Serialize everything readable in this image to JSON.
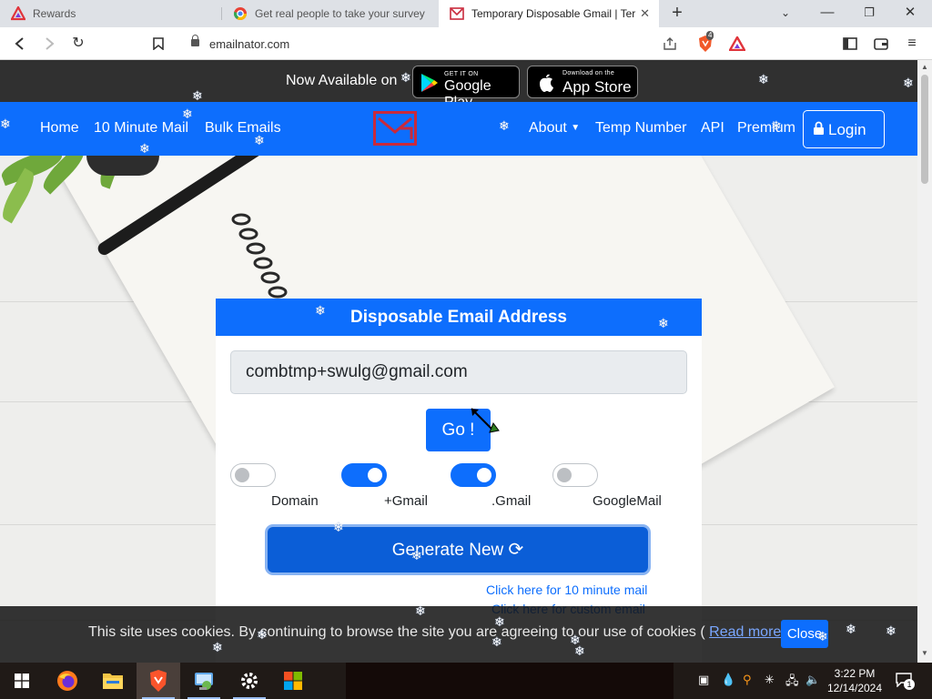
{
  "browser": {
    "tabs": [
      {
        "title": "Rewards",
        "active": false
      },
      {
        "title": "Get real people to take your survey",
        "active": false
      },
      {
        "title": "Temporary Disposable Gmail | Ter",
        "active": true
      }
    ],
    "new_tab": "+",
    "url": "emailnator.com",
    "shields_badge": "4"
  },
  "banner": {
    "text": "Now Available on",
    "google_play_small": "GET IT ON",
    "google_play_big": "Google Play",
    "app_store_small": "Download on the",
    "app_store_big": "App Store"
  },
  "nav": {
    "home": "Home",
    "ten_minute_mail": "10 Minute Mail",
    "bulk_emails": "Bulk Emails",
    "about": "About",
    "temp_number": "Temp Number",
    "api": "API",
    "premium": "Premium",
    "login": "Login"
  },
  "card": {
    "title": "Disposable Email Address",
    "email_value": "combtmp+swulg@gmail.com",
    "go_label": "Go !",
    "options": [
      {
        "label": "Domain",
        "enabled": false
      },
      {
        "label": "+Gmail",
        "enabled": true
      },
      {
        "label": ".Gmail",
        "enabled": true
      },
      {
        "label": "GoogleMail",
        "enabled": false
      }
    ],
    "generate_label": "Generate New",
    "link_ten_minute": "Click here for 10 minute mail",
    "link_custom": "Click here for custom email"
  },
  "cookie": {
    "text_before": "This site uses cookies. By continuing to browse the site you are agreeing to our use of cookies (",
    "read_more": "Read more",
    "text_after": ")",
    "close_label": "Close"
  },
  "taskbar": {
    "apps": [
      "firefox-icon",
      "file-explorer-icon",
      "brave-icon",
      "control-panel-icon",
      "settings-icon",
      "microsoft-store-icon"
    ],
    "time": "3:22 PM",
    "date": "12/14/2024",
    "notification_count": "1"
  },
  "colors": {
    "brand_blue": "#0d6efd",
    "banner_dark": "#303030",
    "logo_red": "#c92a3c"
  }
}
